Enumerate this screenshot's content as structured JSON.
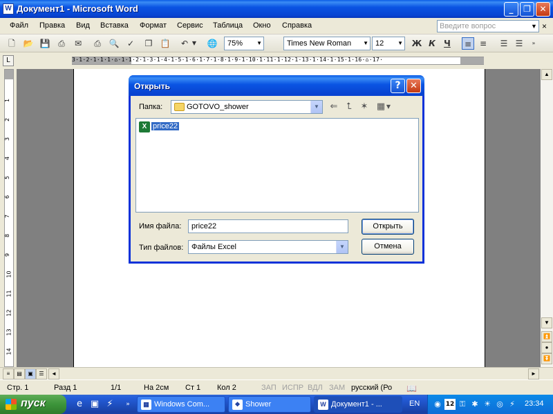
{
  "window": {
    "title": "Документ1 - Microsoft Word",
    "minimize": "_",
    "maximize": "❐",
    "close": "✕"
  },
  "menu": {
    "items": [
      "Файл",
      "Правка",
      "Вид",
      "Вставка",
      "Формат",
      "Сервис",
      "Таблица",
      "Окно",
      "Справка"
    ],
    "help_placeholder": "Введите вопрос"
  },
  "toolbar": {
    "zoom": "75%",
    "font": "Times New Roman",
    "font_size": "12",
    "bold": "Ж",
    "italic": "К",
    "underline": "Ч"
  },
  "ruler": {
    "marks": "3·1·2·1·1·1·⌂·1·1·2·1·3·1·4·1·5·1·6·1·7·1·8·1·9·1·10·1·11·1·12·1·13·1·14·1·15·1·16·⌂·17·"
  },
  "vruler": {
    "marks": [
      "1",
      "2",
      "3",
      "4",
      "5",
      "6",
      "7",
      "8",
      "9",
      "10",
      "11",
      "12",
      "13",
      "14"
    ]
  },
  "dialog": {
    "title": "Открыть",
    "folder_label": "Папка:",
    "folder_value": "GOTOVO_shower",
    "files": [
      {
        "name": "price22",
        "type": "excel",
        "selected": true
      }
    ],
    "filename_label": "Имя файла:",
    "filename_value": "price22",
    "filetype_label": "Тип файлов:",
    "filetype_value": "Файлы Excel",
    "open_button": "Открыть",
    "cancel_button": "Отмена"
  },
  "statusbar": {
    "page": "Стр. 1",
    "section": "Разд 1",
    "pages": "1/1",
    "at": "На 2см",
    "line": "Ст 1",
    "col": "Кол 2",
    "rec": "ЗАП",
    "trk": "ИСПР",
    "ext": "ВДЛ",
    "ovr": "ЗАМ",
    "language": "русский (Ро"
  },
  "taskbar": {
    "start_label": "пуск",
    "tasks": [
      {
        "label": "Windows Com...",
        "icon": "windows-commander-icon",
        "active": false
      },
      {
        "label": "Shower",
        "icon": "shower-app-icon",
        "active": false
      },
      {
        "label": "Документ1 - ...",
        "icon": "word-icon",
        "active": true
      }
    ],
    "language": "EN",
    "clock": "23:34",
    "tray_date_icon": "12"
  }
}
